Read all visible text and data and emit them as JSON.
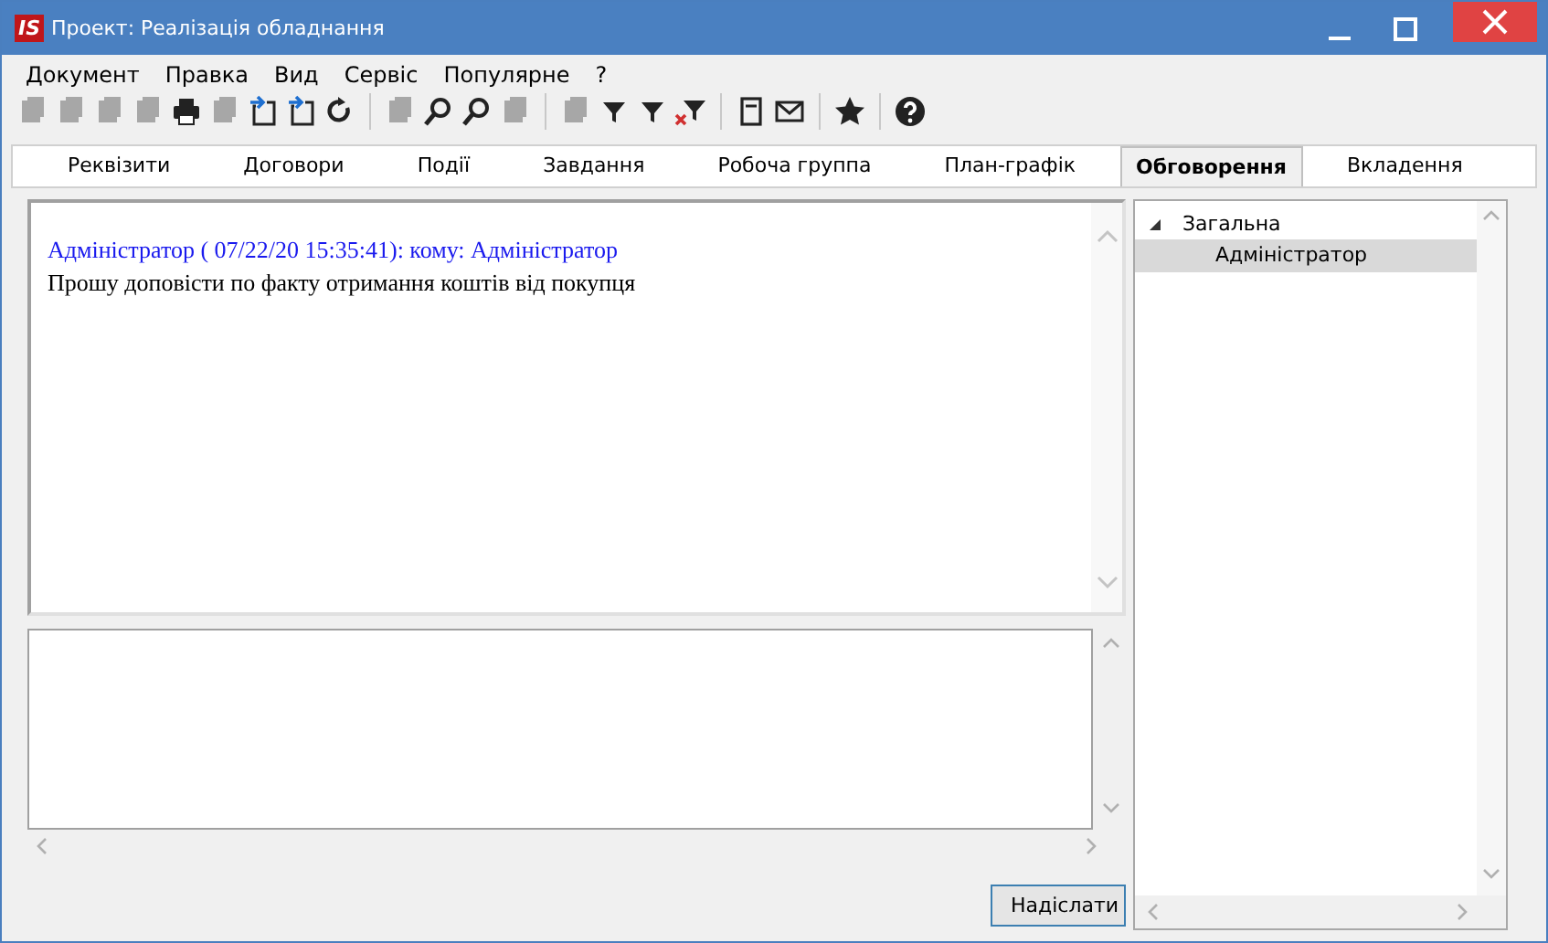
{
  "window": {
    "title": "Проект: Реалізація обладнання",
    "logo": "IS"
  },
  "menu": [
    "Документ",
    "Правка",
    "Вид",
    "Сервіс",
    "Популярне",
    "?"
  ],
  "toolbar": [
    {
      "kind": "doc",
      "disabled": true
    },
    {
      "kind": "doc",
      "disabled": true
    },
    {
      "kind": "doc",
      "disabled": true
    },
    {
      "kind": "doc",
      "disabled": true
    },
    {
      "kind": "print",
      "disabled": false
    },
    {
      "kind": "doc",
      "disabled": true
    },
    {
      "kind": "import",
      "disabled": false
    },
    {
      "kind": "import",
      "disabled": false
    },
    {
      "kind": "refresh",
      "disabled": false
    },
    {
      "kind": "sep"
    },
    {
      "kind": "doc",
      "disabled": true
    },
    {
      "kind": "search",
      "disabled": false
    },
    {
      "kind": "search",
      "disabled": false
    },
    {
      "kind": "doc",
      "disabled": true
    },
    {
      "kind": "sep"
    },
    {
      "kind": "doc",
      "disabled": true
    },
    {
      "kind": "filter",
      "disabled": false
    },
    {
      "kind": "filter",
      "disabled": false
    },
    {
      "kind": "filterx",
      "disabled": false
    },
    {
      "kind": "sep"
    },
    {
      "kind": "page",
      "disabled": false
    },
    {
      "kind": "mail",
      "disabled": false
    },
    {
      "kind": "sep"
    },
    {
      "kind": "star",
      "disabled": false
    },
    {
      "kind": "sep"
    },
    {
      "kind": "help",
      "disabled": false
    }
  ],
  "tabs": [
    {
      "label": "Реквізити",
      "selected": false
    },
    {
      "label": "Договори",
      "selected": false
    },
    {
      "label": "Події",
      "selected": false
    },
    {
      "label": "Завдання",
      "selected": false
    },
    {
      "label": "Робоча группа",
      "selected": false
    },
    {
      "label": "План-графік",
      "selected": false
    },
    {
      "label": "Обговорення",
      "selected": true
    },
    {
      "label": "Вкладення",
      "selected": false
    }
  ],
  "messages": [
    {
      "header": "Адміністратор ( 07/22/20 15:35:41): кому: Адміністратор",
      "text": "Прошу доповісти по факту отримання коштів від покупця"
    }
  ],
  "send_button": "Надіслати",
  "tree": [
    {
      "label": "Загальна",
      "expanded": true,
      "selected": false,
      "children": [
        {
          "label": "Адміністратор",
          "selected": true
        }
      ]
    }
  ]
}
